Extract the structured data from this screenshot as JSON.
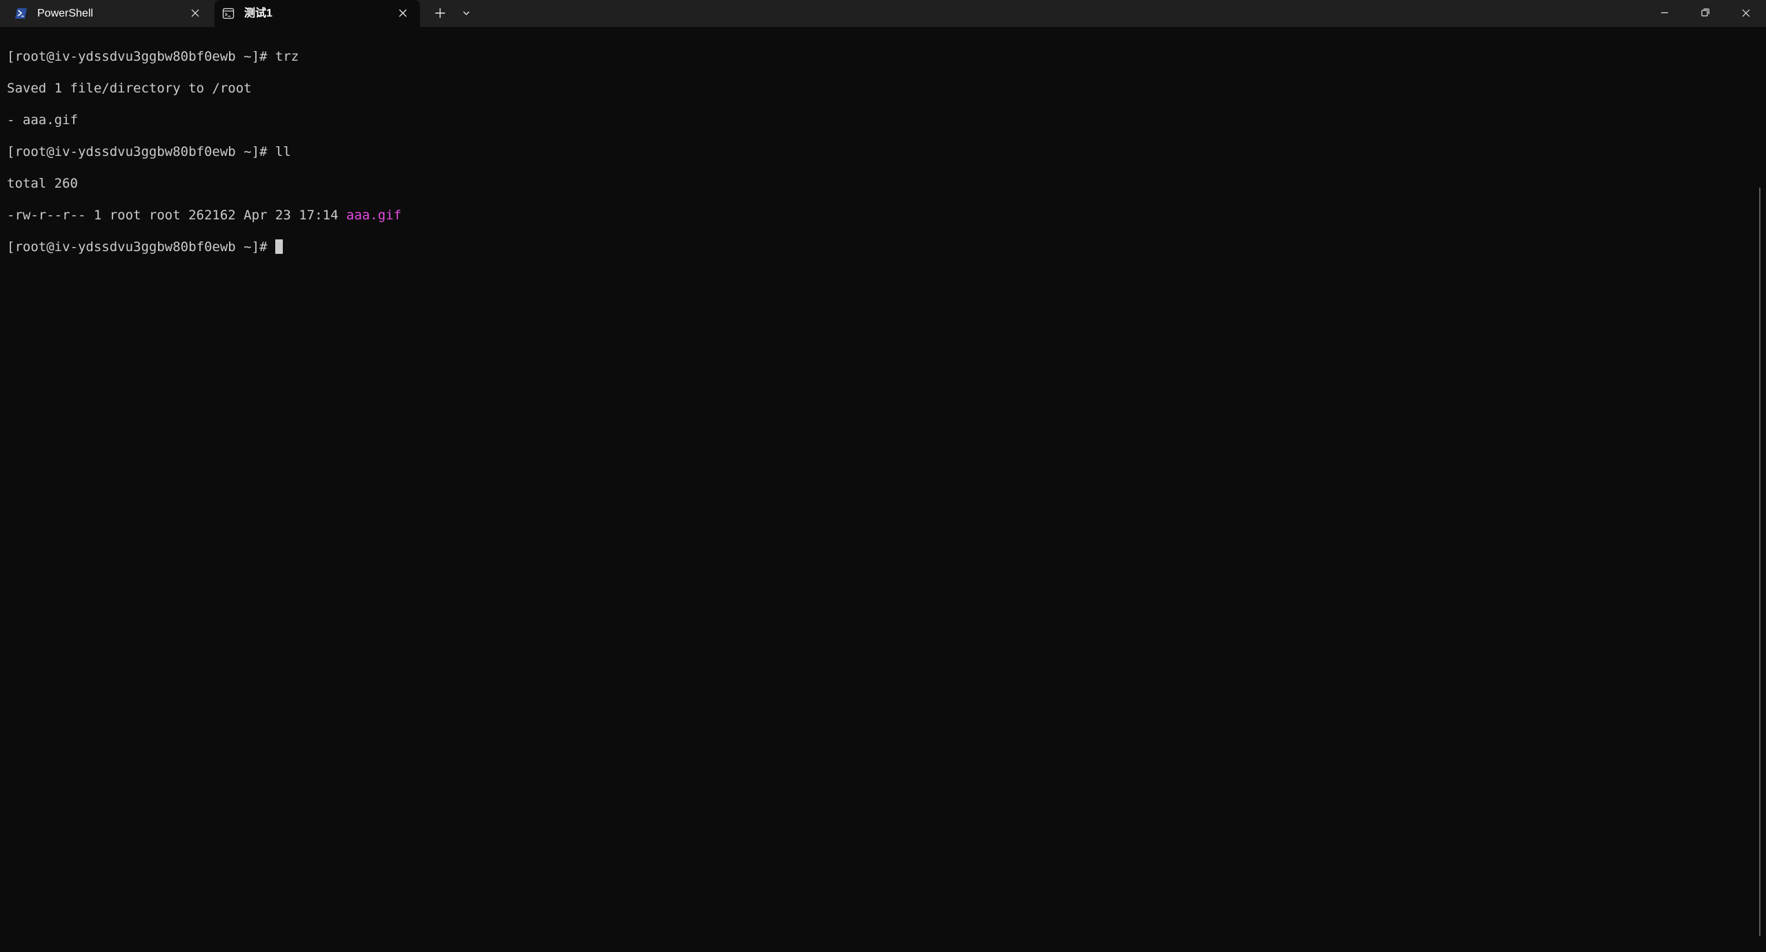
{
  "tabs": [
    {
      "label": "PowerShell",
      "icon": "powershell-icon",
      "active": false
    },
    {
      "label": "测试1",
      "icon": "terminal-tab-icon",
      "active": true
    }
  ],
  "titlebar": {
    "new_tab_icon": "plus-icon",
    "dropdown_icon": "chevron-down-icon"
  },
  "window_controls": [
    "minimize-icon",
    "restore-icon",
    "close-icon"
  ],
  "terminal": {
    "lines": [
      "[root@iv-ydssdvu3ggbw80bf0ewb ~]# trz",
      "Saved 1 file/directory to /root",
      "- aaa.gif",
      "[root@iv-ydssdvu3ggbw80bf0ewb ~]# ll",
      "total 260"
    ],
    "listing_prefix": "-rw-r--r-- 1 root root 262162 Apr 23 17:14 ",
    "listing_file": "aaa.gif",
    "prompt": "[root@iv-ydssdvu3ggbw80bf0ewb ~]# "
  },
  "colors": {
    "background": "#0c0c0c",
    "titlebar": "#202020",
    "foreground": "#cccccc",
    "file_highlight": "#e34ce3"
  }
}
